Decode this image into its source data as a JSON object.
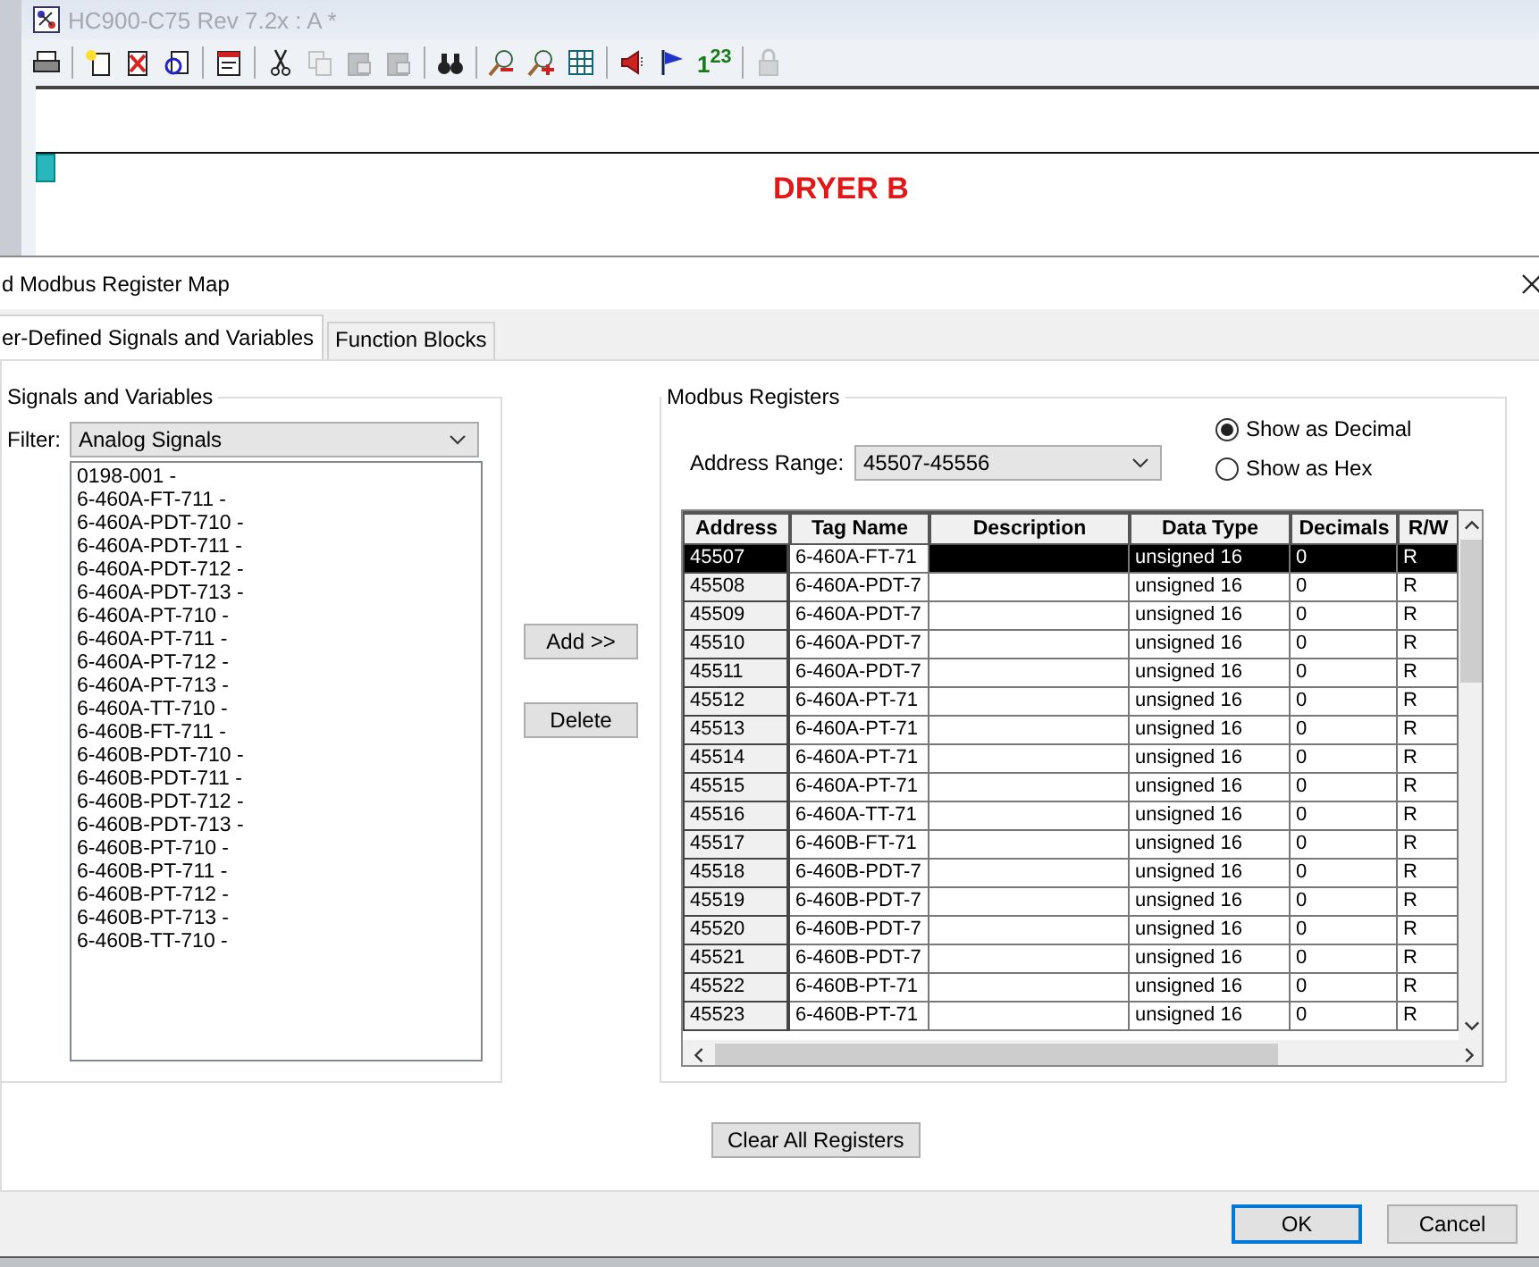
{
  "app_window": {
    "title": "HC900-C75 Rev 7.2x : A *",
    "numbering_button": "1$^{2}$$^{3}$",
    "canvas_title": "DRYER B"
  },
  "dialog": {
    "title": "d Modbus Register Map",
    "tabs": [
      {
        "label": "er-Defined Signals and Variables",
        "selected": true
      },
      {
        "label": "Function Blocks",
        "selected": false
      }
    ],
    "signals_group": {
      "title": "Signals and Variables",
      "filter_label": "Filter:",
      "filter_value": "Analog Signals",
      "items": [
        "0198-001 -",
        "6-460A-FT-711 -",
        "6-460A-PDT-710 -",
        "6-460A-PDT-711 -",
        "6-460A-PDT-712 -",
        "6-460A-PDT-713 -",
        "6-460A-PT-710 -",
        "6-460A-PT-711 -",
        "6-460A-PT-712 -",
        "6-460A-PT-713 -",
        "6-460A-TT-710 -",
        "6-460B-FT-711 -",
        "6-460B-PDT-710 -",
        "6-460B-PDT-711 -",
        "6-460B-PDT-712 -",
        "6-460B-PDT-713 -",
        "6-460B-PT-710 -",
        "6-460B-PT-711 -",
        "6-460B-PT-712 -",
        "6-460B-PT-713 -",
        "6-460B-TT-710 -"
      ]
    },
    "add_button": "Add >>",
    "delete_button": "Delete",
    "registers_group": {
      "title": "Modbus Registers",
      "address_range_label": "Address Range:",
      "address_range_value": "45507-45556",
      "display_options": [
        {
          "label": "Show as Decimal",
          "selected": true
        },
        {
          "label": "Show as Hex",
          "selected": false
        }
      ],
      "table": {
        "columns": [
          {
            "label": "Address",
            "focused": false
          },
          {
            "label": "Tag Name",
            "focused": true
          },
          {
            "label": "Description",
            "focused": false
          },
          {
            "label": "Data Type",
            "focused": false
          },
          {
            "label": "Decimals",
            "focused": false
          },
          {
            "label": "R/W",
            "focused": false
          }
        ],
        "rows": [
          {
            "address": "45507",
            "tag_name": "6-460A-FT-71",
            "data_type": "unsigned 16",
            "decimals": "0",
            "rw": "R",
            "selected": true
          },
          {
            "address": "45508",
            "tag_name": "6-460A-PDT-7",
            "data_type": "unsigned 16",
            "decimals": "0",
            "rw": "R",
            "selected": false
          },
          {
            "address": "45509",
            "tag_name": "6-460A-PDT-7",
            "data_type": "unsigned 16",
            "decimals": "0",
            "rw": "R",
            "selected": false
          },
          {
            "address": "45510",
            "tag_name": "6-460A-PDT-7",
            "data_type": "unsigned 16",
            "decimals": "0",
            "rw": "R",
            "selected": false
          },
          {
            "address": "45511",
            "tag_name": "6-460A-PDT-7",
            "data_type": "unsigned 16",
            "decimals": "0",
            "rw": "R",
            "selected": false
          },
          {
            "address": "45512",
            "tag_name": "6-460A-PT-71",
            "data_type": "unsigned 16",
            "decimals": "0",
            "rw": "R",
            "selected": false
          },
          {
            "address": "45513",
            "tag_name": "6-460A-PT-71",
            "data_type": "unsigned 16",
            "decimals": "0",
            "rw": "R",
            "selected": false
          },
          {
            "address": "45514",
            "tag_name": "6-460A-PT-71",
            "data_type": "unsigned 16",
            "decimals": "0",
            "rw": "R",
            "selected": false
          },
          {
            "address": "45515",
            "tag_name": "6-460A-PT-71",
            "data_type": "unsigned 16",
            "decimals": "0",
            "rw": "R",
            "selected": false
          },
          {
            "address": "45516",
            "tag_name": "6-460A-TT-71",
            "data_type": "unsigned 16",
            "decimals": "0",
            "rw": "R",
            "selected": false
          },
          {
            "address": "45517",
            "tag_name": "6-460B-FT-71",
            "data_type": "unsigned 16",
            "decimals": "0",
            "rw": "R",
            "selected": false
          },
          {
            "address": "45518",
            "tag_name": "6-460B-PDT-7",
            "data_type": "unsigned 16",
            "decimals": "0",
            "rw": "R",
            "selected": false
          },
          {
            "address": "45519",
            "tag_name": "6-460B-PDT-7",
            "data_type": "unsigned 16",
            "decimals": "0",
            "rw": "R",
            "selected": false
          },
          {
            "address": "45520",
            "tag_name": "6-460B-PDT-7",
            "data_type": "unsigned 16",
            "decimals": "0",
            "rw": "R",
            "selected": false
          },
          {
            "address": "45521",
            "tag_name": "6-460B-PDT-7",
            "data_type": "unsigned 16",
            "decimals": "0",
            "rw": "R",
            "selected": false
          },
          {
            "address": "45522",
            "tag_name": "6-460B-PT-71",
            "data_type": "unsigned 16",
            "decimals": "0",
            "rw": "R",
            "selected": false
          },
          {
            "address": "45523",
            "tag_name": "6-460B-PT-71",
            "data_type": "unsigned 16",
            "decimals": "0",
            "rw": "R",
            "selected": false
          }
        ]
      }
    },
    "clear_button": "Clear All Registers",
    "buttons": [
      {
        "label": "OK",
        "default": true
      },
      {
        "label": "Cancel",
        "default": false
      }
    ]
  }
}
